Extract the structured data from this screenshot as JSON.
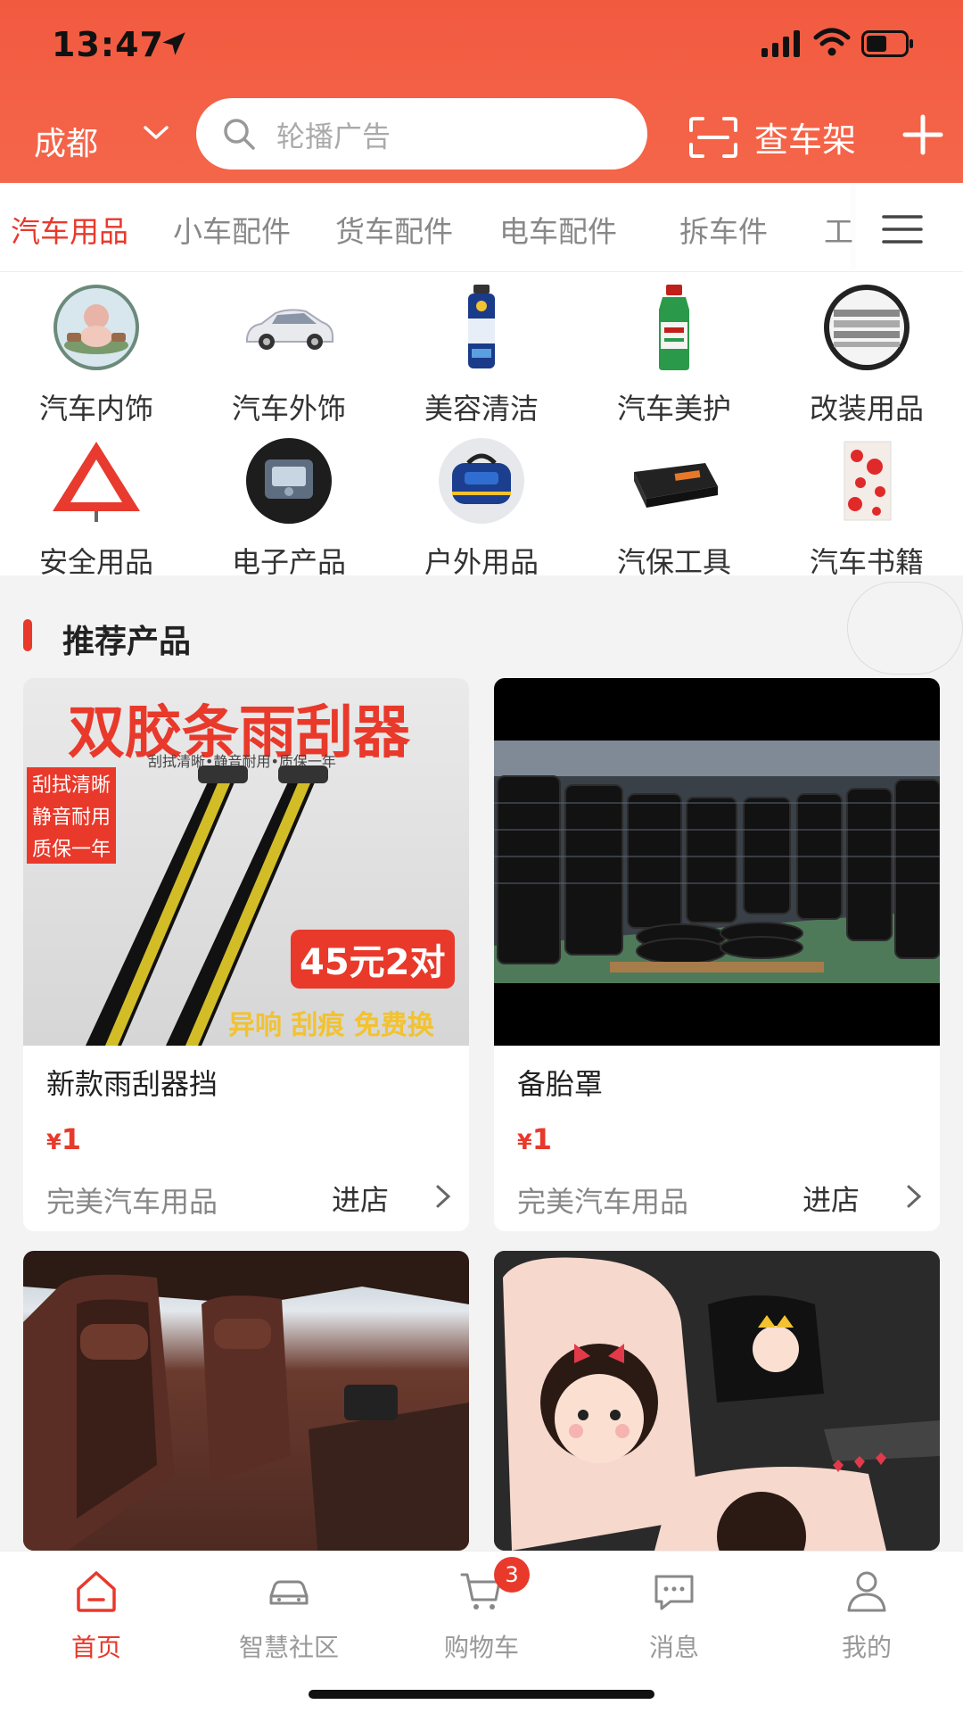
{
  "status_bar": {
    "time": "13:47"
  },
  "header": {
    "city": "成都",
    "search_placeholder": "轮播广告",
    "scan_label": "查车架"
  },
  "category_tabs": [
    {
      "label": "汽车用品",
      "active": true
    },
    {
      "label": "小车配件",
      "active": false
    },
    {
      "label": "货车配件",
      "active": false
    },
    {
      "label": "电车配件",
      "active": false
    },
    {
      "label": "拆车件",
      "active": false
    },
    {
      "label": "工",
      "active": false
    }
  ],
  "grid": [
    {
      "label": "汽车内饰",
      "icon": "interior-icon"
    },
    {
      "label": "汽车外饰",
      "icon": "car-exterior-icon"
    },
    {
      "label": "美容清洁",
      "icon": "spray-can-icon"
    },
    {
      "label": "汽车美护",
      "icon": "care-bottle-icon"
    },
    {
      "label": "改装用品",
      "icon": "grille-icon"
    },
    {
      "label": "安全用品",
      "icon": "warning-triangle-icon"
    },
    {
      "label": "电子产品",
      "icon": "electronics-icon"
    },
    {
      "label": "户外用品",
      "icon": "outdoor-bag-icon"
    },
    {
      "label": "汽保工具",
      "icon": "toolbox-icon"
    },
    {
      "label": "汽车书籍",
      "icon": "book-icon"
    }
  ],
  "recommend": {
    "title": "推荐产品",
    "products": [
      {
        "name": "新款雨刮器挡",
        "price_symbol": "¥",
        "price": "1",
        "shop": "完美汽车用品",
        "enter": "进店",
        "image_text": {
          "headline": "双胶条雨刮器",
          "sub": "刮拭清晰•静音耐用•质保一年",
          "tag1": "刮拭清晰",
          "tag2": "静音耐用",
          "tag3": "质保一年",
          "promo": "45元2对",
          "bottom": "异响 刮痕 免费换"
        }
      },
      {
        "name": "备胎罩",
        "price_symbol": "¥",
        "price": "1",
        "shop": "完美汽车用品",
        "enter": "进店"
      },
      {
        "image": "car-seat-leather"
      },
      {
        "image": "car-seat-cartoon"
      }
    ]
  },
  "tabbar": [
    {
      "label": "首页",
      "icon": "home-icon",
      "active": true
    },
    {
      "label": "智慧社区",
      "icon": "car-icon",
      "active": false
    },
    {
      "label": "购物车",
      "icon": "cart-icon",
      "active": false,
      "badge": "3"
    },
    {
      "label": "消息",
      "icon": "message-icon",
      "active": false
    },
    {
      "label": "我的",
      "icon": "user-icon",
      "active": false
    }
  ],
  "colors": {
    "accent": "#e8392b",
    "header": "#f25a40"
  }
}
